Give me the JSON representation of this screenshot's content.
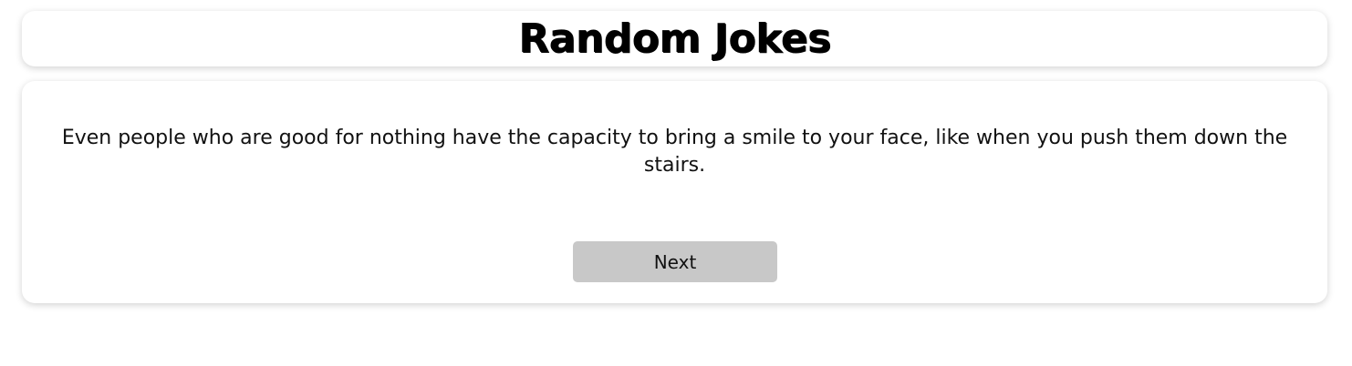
{
  "header": {
    "title": "Random Jokes"
  },
  "joke": {
    "text": "Even people who are good for nothing have the capacity to bring a smile to your face, like when you push them down the stairs."
  },
  "controls": {
    "next_label": "Next"
  },
  "colors": {
    "background": "#ffffff",
    "card": "#ffffff",
    "button": "#c8c8c8",
    "text": "#000000"
  }
}
